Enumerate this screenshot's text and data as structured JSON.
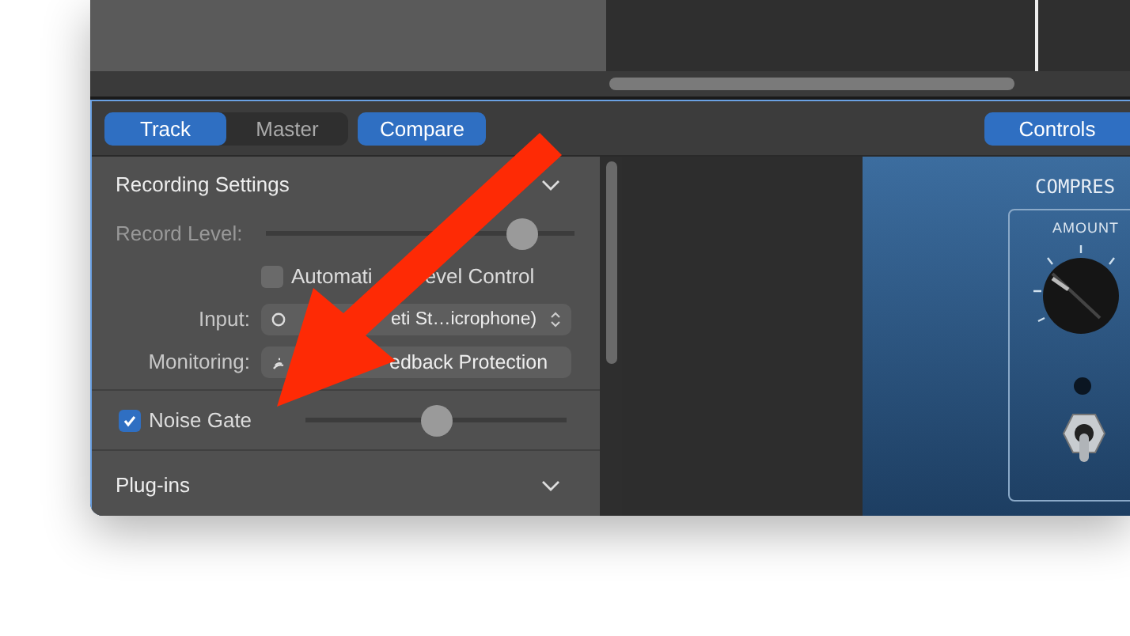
{
  "tabs": [
    {
      "label": "Track",
      "selected": true
    },
    {
      "label": "Master",
      "selected": false
    }
  ],
  "compare": {
    "label": "Compare",
    "on": true
  },
  "controls": {
    "label": "Controls",
    "on": true
  },
  "recording_settings": {
    "title": "Recording Settings",
    "expanded": true,
    "record_level": {
      "label": "Record Level:",
      "level": 0.83
    },
    "automatic_level_control": {
      "label_parts": [
        "Automati",
        "evel Control"
      ],
      "checked": false
    },
    "input": {
      "label": "Input:",
      "value": "eti St…icrophone)"
    },
    "monitoring": {
      "label": "Monitoring:",
      "value": "edback Protection"
    }
  },
  "noise_gate": {
    "label": "Noise Gate",
    "checked": true,
    "level": 0.5
  },
  "plugins": {
    "title": "Plug-ins",
    "expanded": false
  },
  "plugin_panel": {
    "title": "COMPRES",
    "knob_label": "AMOUNT",
    "switch_on": false
  }
}
